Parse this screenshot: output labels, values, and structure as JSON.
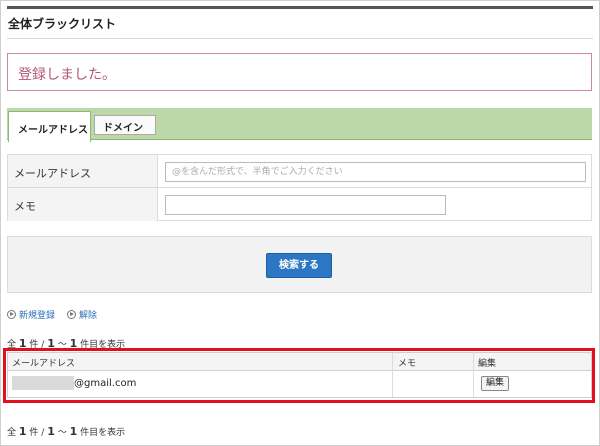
{
  "page": {
    "title": "全体ブラックリスト"
  },
  "alert": {
    "message": "登録しました。"
  },
  "tabs": [
    {
      "label": "メールアドレス",
      "active": true
    },
    {
      "label": "ドメイン",
      "active": false
    }
  ],
  "form": {
    "email_label": "メールアドレス",
    "email_placeholder": "@を含んだ形式で、半角でご入力ください",
    "email_value": "",
    "memo_label": "メモ",
    "memo_value": ""
  },
  "search": {
    "button_label": "検索する"
  },
  "actions": {
    "new_label": "新規登録",
    "release_label": "解除"
  },
  "counts": {
    "prefix": "全",
    "total": "1",
    "unit1": "件 /",
    "from": "1",
    "range_sep": "～",
    "to": "1",
    "suffix": "件目を表示"
  },
  "list": {
    "headers": {
      "email": "メールアドレス",
      "memo": "メモ",
      "edit": "編集"
    },
    "rows": [
      {
        "email": "@gmail.com",
        "memo": "",
        "edit_label": "編集"
      }
    ]
  },
  "colors": {
    "accent": "#2c77c4",
    "highlight": "#e30e1d",
    "tab_bar": "#bcd8a8",
    "alert_text": "#b0587a"
  }
}
